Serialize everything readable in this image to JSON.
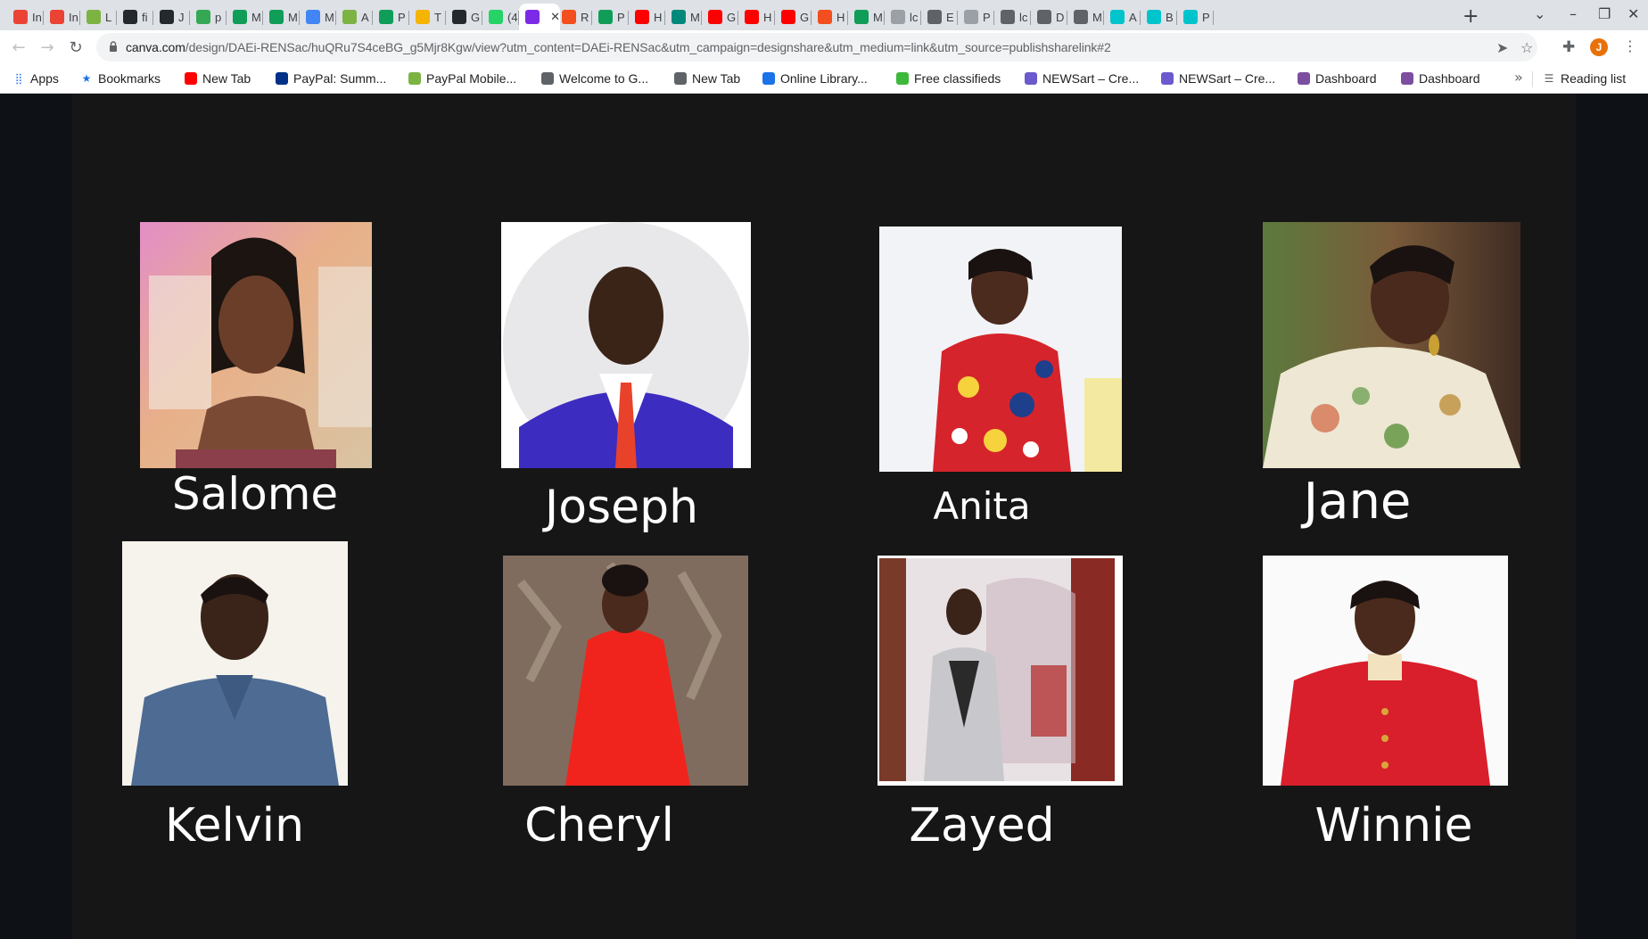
{
  "browser": {
    "tabs": [
      {
        "title": "In",
        "icon": "gmail-icon",
        "color": "#ea4335"
      },
      {
        "title": "In",
        "icon": "gmail-icon",
        "color": "#ea4335"
      },
      {
        "title": "L",
        "icon": "plant-icon",
        "color": "#7cb342"
      },
      {
        "title": "fi",
        "icon": "github-icon",
        "color": "#24292e"
      },
      {
        "title": "J",
        "icon": "github-icon",
        "color": "#24292e"
      },
      {
        "title": "p",
        "icon": "sync-icon",
        "color": "#34a853"
      },
      {
        "title": "M",
        "icon": "sheets-plus-icon",
        "color": "#0f9d58"
      },
      {
        "title": "M",
        "icon": "sheets-plus-icon",
        "color": "#0f9d58"
      },
      {
        "title": "M",
        "icon": "calendar-icon",
        "color": "#4285f4"
      },
      {
        "title": "A",
        "icon": "plant-icon",
        "color": "#7cb342"
      },
      {
        "title": "P",
        "icon": "sheets-plus-icon",
        "color": "#0f9d58"
      },
      {
        "title": "T",
        "icon": "slides-icon",
        "color": "#f4b400"
      },
      {
        "title": "G",
        "icon": "github-icon",
        "color": "#24292e"
      },
      {
        "title": "(4",
        "icon": "whatsapp-icon",
        "color": "#25d366"
      },
      {
        "title": "",
        "icon": "canva-icon",
        "color": "#7d2ae8",
        "active": true
      },
      {
        "title": "R",
        "icon": "figma-icon",
        "color": "#f24e1e"
      },
      {
        "title": "P",
        "icon": "sheets-plus-icon",
        "color": "#0f9d58"
      },
      {
        "title": "H",
        "icon": "youtube-icon",
        "color": "#ff0000"
      },
      {
        "title": "M",
        "icon": "meet-icon",
        "color": "#00897b"
      },
      {
        "title": "G",
        "icon": "youtube-icon",
        "color": "#ff0000"
      },
      {
        "title": "H",
        "icon": "youtube-icon",
        "color": "#ff0000"
      },
      {
        "title": "G",
        "icon": "youtube-icon",
        "color": "#ff0000"
      },
      {
        "title": "H",
        "icon": "figma-icon",
        "color": "#f24e1e"
      },
      {
        "title": "M",
        "icon": "sheets-plus-icon",
        "color": "#0f9d58"
      },
      {
        "title": "lc",
        "icon": "chart-icon",
        "color": "#9aa0a6"
      },
      {
        "title": "E",
        "icon": "globe-icon",
        "color": "#5f6368"
      },
      {
        "title": "P",
        "icon": "r-icon",
        "color": "#9aa0a6"
      },
      {
        "title": "lc",
        "icon": "globe-icon",
        "color": "#5f6368"
      },
      {
        "title": "D",
        "icon": "globe-icon",
        "color": "#5f6368"
      },
      {
        "title": "M",
        "icon": "globe-icon",
        "color": "#5f6368"
      },
      {
        "title": "A",
        "icon": "canva-icon",
        "color": "#00c4cc"
      },
      {
        "title": "B",
        "icon": "canva-icon",
        "color": "#00c4cc"
      },
      {
        "title": "P",
        "icon": "canva-icon",
        "color": "#00c4cc"
      }
    ],
    "url_host": "canva.com",
    "url_path": "/design/DAEi-RENSac/huQRu7S4ceBG_g5Mjr8Kgw/view?utm_content=DAEi-RENSac&utm_campaign=designshare&utm_medium=link&utm_source=publishsharelink#2",
    "profile_initial": "J",
    "bookmarks": [
      {
        "label": "Apps",
        "icon": "apps-grid-icon",
        "color": "#4285f4"
      },
      {
        "label": "Bookmarks",
        "icon": "star-icon",
        "color": "#1a73e8"
      },
      {
        "label": "New Tab",
        "icon": "youtube-icon",
        "color": "#ff0000"
      },
      {
        "label": "PayPal: Summ...",
        "icon": "paypal-icon",
        "color": "#003087"
      },
      {
        "label": "PayPal Mobile...",
        "icon": "tumblr-icon",
        "color": "#7cb342"
      },
      {
        "label": "Welcome to G...",
        "icon": "globe-icon",
        "color": "#5f6368"
      },
      {
        "label": "New Tab",
        "icon": "globe-icon",
        "color": "#5f6368"
      },
      {
        "label": "Online Library...",
        "icon": "library-icon",
        "color": "#1a73e8"
      },
      {
        "label": "Free classifieds",
        "icon": "jiji-icon",
        "color": "#3db83a"
      },
      {
        "label": "NEWSart – Cre...",
        "icon": "newsart-icon",
        "color": "#6a5acd"
      },
      {
        "label": "NEWSart – Cre...",
        "icon": "newsart-icon",
        "color": "#6a5acd"
      },
      {
        "label": "Dashboard",
        "icon": "dashboard-icon",
        "color": "#7b4ea0"
      },
      {
        "label": "Dashboard",
        "icon": "dashboard-icon",
        "color": "#7b4ea0"
      }
    ],
    "reading_list": "Reading list"
  },
  "slide": {
    "people": [
      {
        "name": "Salome"
      },
      {
        "name": "Joseph"
      },
      {
        "name": "Anita"
      },
      {
        "name": "Jane"
      },
      {
        "name": "Kelvin"
      },
      {
        "name": "Cheryl"
      },
      {
        "name": "Zayed"
      },
      {
        "name": "Winnie"
      }
    ]
  }
}
